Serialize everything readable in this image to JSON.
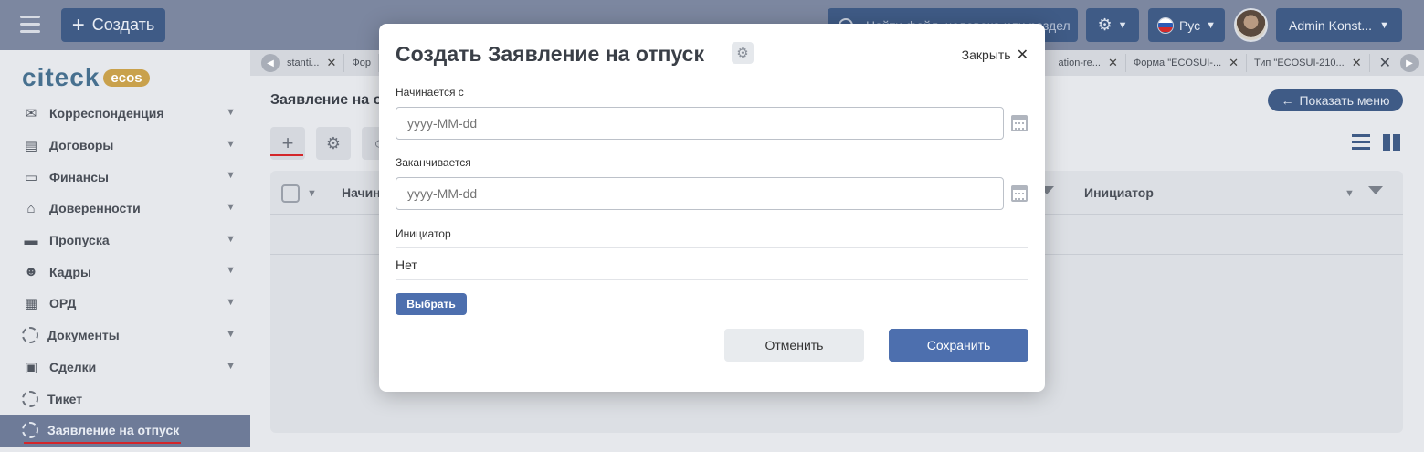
{
  "topbar": {
    "create_label": "Создать",
    "search_placeholder": "Найти файл, человека или раздел",
    "language": "Рус",
    "user_name": "Admin Konst..."
  },
  "sidebar": {
    "logo_text": "citeck",
    "logo_badge": "ecos",
    "items": [
      {
        "label": "Корреспонденция",
        "icon": "envelope-icon"
      },
      {
        "label": "Договоры",
        "icon": "document-icon"
      },
      {
        "label": "Финансы",
        "icon": "credit-card-icon"
      },
      {
        "label": "Доверенности",
        "icon": "bank-icon"
      },
      {
        "label": "Пропуска",
        "icon": "pass-card-icon"
      },
      {
        "label": "Кадры",
        "icon": "people-icon"
      },
      {
        "label": "ОРД",
        "icon": "newspaper-icon"
      },
      {
        "label": "Документы",
        "icon": "dashed-circle-icon"
      },
      {
        "label": "Сделки",
        "icon": "deal-icon"
      },
      {
        "label": "Тикет",
        "icon": "dashed-circle-icon"
      },
      {
        "label": "Заявление на отпуск",
        "icon": "dashed-circle-icon",
        "active": true
      }
    ]
  },
  "tabs": [
    {
      "label": "stanti..."
    },
    {
      "label": "Фор"
    },
    {
      "label": "ation-re..."
    },
    {
      "label": "Форма \"ECOSUI-..."
    },
    {
      "label": "Тип \"ECOSUI-210..."
    }
  ],
  "main": {
    "page_title": "Заявление на о",
    "show_menu_label": "Показать меню",
    "columns": [
      {
        "label": "Начин"
      },
      {
        "label": "Инициатор"
      }
    ]
  },
  "modal": {
    "title": "Создать Заявление на отпуск",
    "close_label": "Закрыть",
    "start_label": "Начинается с",
    "start_placeholder": "yyyy-MM-dd",
    "end_label": "Заканчивается",
    "end_placeholder": "yyyy-MM-dd",
    "initiator_label": "Инициатор",
    "initiator_value": "Нет",
    "select_label": "Выбрать",
    "cancel_label": "Отменить",
    "save_label": "Сохранить"
  },
  "colors": {
    "topbar": "#7c87a0",
    "primary_button": "#4d6fae",
    "dark_button": "#3f5b86",
    "active_underline": "#d3262a"
  }
}
